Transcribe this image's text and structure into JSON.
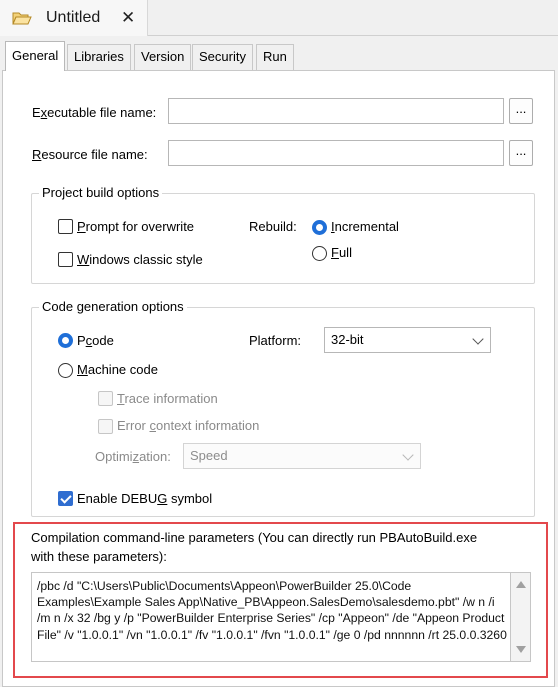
{
  "document_tab": {
    "title": "Untitled",
    "close_glyph": "✕",
    "icon": "folder-open-icon"
  },
  "property_tabs": [
    {
      "label": "General",
      "active": true
    },
    {
      "label": "Libraries",
      "active": false
    },
    {
      "label": "Version",
      "active": false
    },
    {
      "label": "Security",
      "active": false
    },
    {
      "label": "Run",
      "active": false
    }
  ],
  "general": {
    "executable_label_pre": "E",
    "executable_label_u": "x",
    "executable_label_post": "ecutable file name:",
    "executable_value": "",
    "resource_label_u": "R",
    "resource_label_post": "esource file name:",
    "resource_value": "",
    "browse_label": "..."
  },
  "build_options": {
    "title": "Project build options",
    "prompt_overwrite": {
      "u": "P",
      "rest": "rompt for overwrite",
      "checked": false
    },
    "windows_classic": {
      "u": "W",
      "rest": "indows classic style",
      "checked": false
    },
    "rebuild_label": "Rebuild:",
    "incremental": {
      "u": "I",
      "rest": "ncremental",
      "selected": true
    },
    "full": {
      "u": "F",
      "rest": "ull",
      "selected": false
    }
  },
  "code_gen": {
    "title": "Code generation options",
    "pcode": {
      "pre": "P",
      "u": "c",
      "rest": "ode",
      "selected": true
    },
    "machine_code": {
      "u": "M",
      "rest": "achine code",
      "selected": false
    },
    "platform_label": "Platform:",
    "platform_value": "32-bit",
    "trace_info": {
      "u": "T",
      "rest": "race information",
      "checked": false
    },
    "error_context": {
      "pre": "Error ",
      "u": "c",
      "rest": "ontext information",
      "checked": false
    },
    "optimization_label": "Optimi",
    "optimization_label_u": "z",
    "optimization_label_post": "ation:",
    "optimization_value": "Speed",
    "debug": {
      "pre": "Enable DEBU",
      "u": "G",
      "rest": " symbol",
      "checked": true
    }
  },
  "compilation": {
    "label_line1": "Compilation command-line parameters (You can directly run PBAutoBuild.exe",
    "label_line2": "with these parameters):",
    "params": "/pbc /d \"C:\\Users\\Public\\Documents\\Appeon\\PowerBuilder 25.0\\Code Examples\\Example Sales App\\Native_PB\\Appeon.SalesDemo\\salesdemo.pbt\" /w n /i /m n /x 32 /bg y /p \"PowerBuilder Enterprise Series\" /cp \"Appeon\" /de \"Appeon Product File\" /v \"1.0.0.1\" /vn \"1.0.0.1\" /fv \"1.0.0.1\" /fvn \"1.0.0.1\" /ge 0 /pd nnnnnn /rt 25.0.0.3260"
  },
  "colors": {
    "accent": "#1f6fd8",
    "highlight": "#e3484c"
  }
}
